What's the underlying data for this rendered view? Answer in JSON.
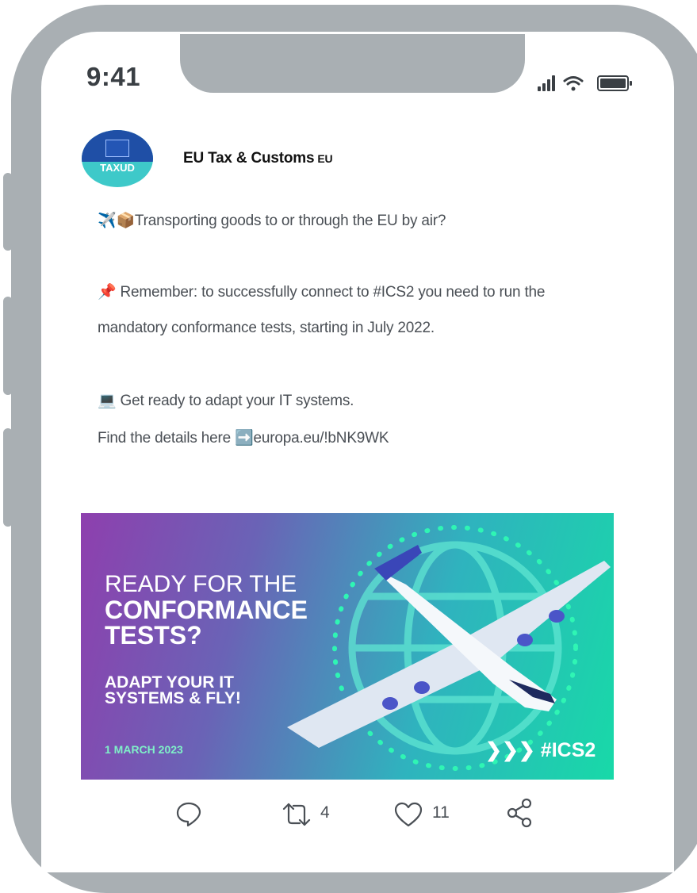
{
  "status_bar": {
    "time": "9:41"
  },
  "account": {
    "avatar_label": "TAXUD",
    "name": "EU Tax & Customs",
    "name_suffix": "EU"
  },
  "tweet": {
    "line1": "✈️📦Transporting goods to or through the EU by air?",
    "line2": "📌 Remember: to successfully connect to #ICS2 you need to run the",
    "line3": "mandatory conformance tests, starting in July 2022.",
    "line4": "💻 Get ready to adapt your IT systems.",
    "line5": "Find the details here ➡️europa.eu/!bNK9WK"
  },
  "banner": {
    "line1": "READY FOR THE",
    "line2": "CONFORMANCE",
    "line3": "TESTS?",
    "line4": "ADAPT YOUR IT",
    "line5": "SYSTEMS & FLY!",
    "date": "1 MARCH 2023",
    "tag": "❯❯❯ #ICS2",
    "colors": {
      "gradient_start": "#8e3fae",
      "gradient_end": "#18d9a8",
      "date_color": "#7ff0c8"
    }
  },
  "actions": {
    "reply_icon": "reply-icon",
    "retweet_icon": "retweet-icon",
    "retweets": "4",
    "like_icon": "heart-icon",
    "likes": "11",
    "share_icon": "share-icon"
  }
}
